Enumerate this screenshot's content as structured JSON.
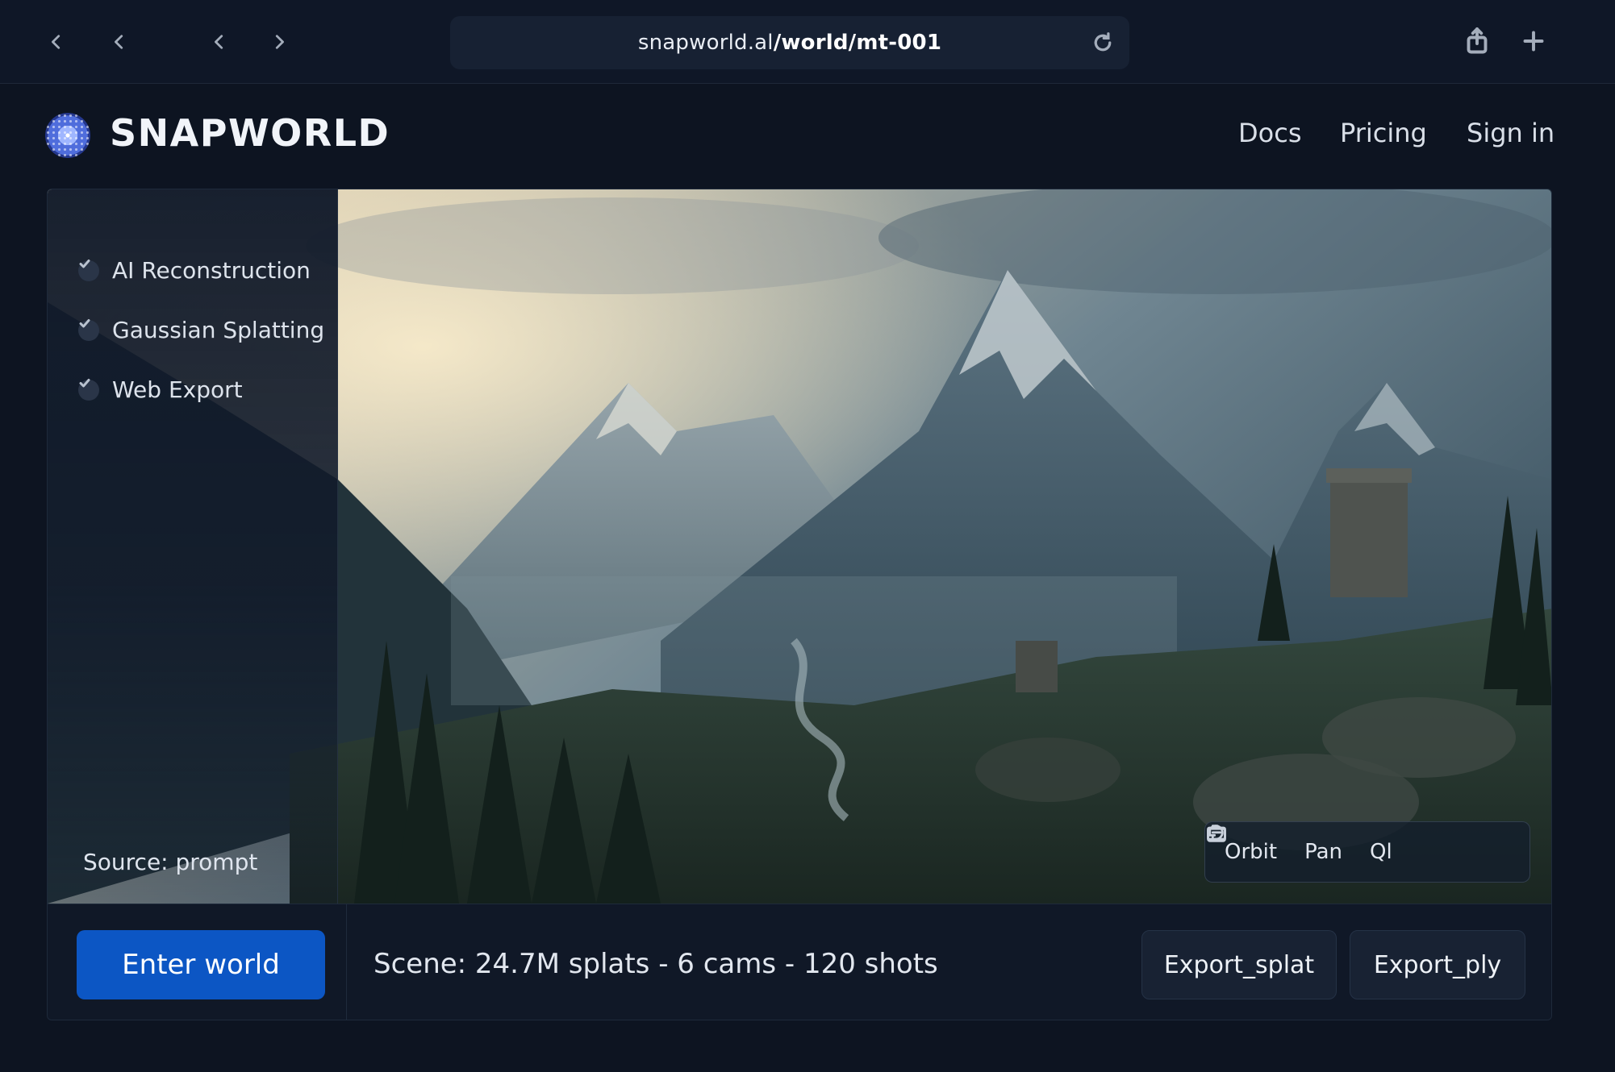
{
  "browser": {
    "url_domain": "snapworld.al",
    "url_path": "/world/mt-001"
  },
  "header": {
    "logo_text": "SNAPWORLD",
    "links": [
      "Docs",
      "Pricing",
      "Sign in"
    ]
  },
  "features": [
    {
      "label": "AI Reconstruction",
      "checked": true
    },
    {
      "label": "Gaussian Splatting",
      "checked": true
    },
    {
      "label": "Web Export",
      "checked": true
    }
  ],
  "scene": {
    "source_label": "Source: prompt",
    "stats": "Scene: 24.7M splats - 6 cams - 120 shots"
  },
  "view_controls": [
    {
      "label": "Orbit",
      "icon": "orbit-icon"
    },
    {
      "label": "Pan",
      "icon": "pan-icon"
    },
    {
      "label": "Ql",
      "icon": "camera-frame-icon"
    }
  ],
  "actions": {
    "enter_world": "Enter world",
    "export_splat": "Export_splat",
    "export_ply": "Export_ply"
  },
  "colors": {
    "background": "#0d1421",
    "primary_button": "#0c56c4",
    "card": "#111a2a"
  }
}
